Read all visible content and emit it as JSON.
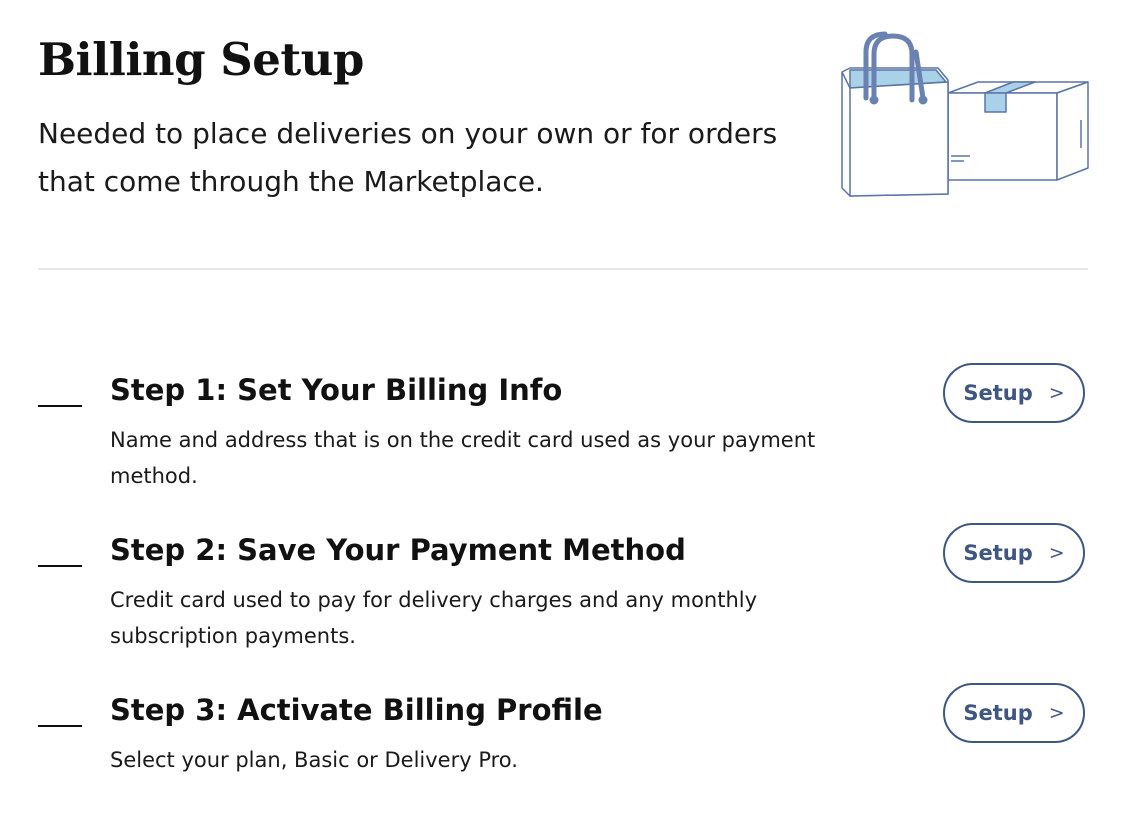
{
  "header": {
    "title": "Billing Setup",
    "subtitle": "Needed to place deliveries on your own or for orders that come through the Marketplace."
  },
  "illustration": {
    "icons": [
      "shopping-bag-icon",
      "shipping-box-icon"
    ]
  },
  "steps": [
    {
      "title": "Step 1: Set Your Billing Info",
      "description": "Name and address that is on the credit card used as your payment method.",
      "button_label": "Setup",
      "button_icon_glyph": ">"
    },
    {
      "title": "Step 2: Save Your Payment Method",
      "description": "Credit card used to pay for delivery charges and any monthly subscription payments.",
      "button_label": "Setup",
      "button_icon_glyph": ">"
    },
    {
      "title": "Step 3: Activate Billing Profile",
      "description": "Select your plan, Basic or Delivery Pro.",
      "button_label": "Setup",
      "button_icon_glyph": ">"
    }
  ],
  "colors": {
    "accent": "#3e5682",
    "illustration_blue": "#a9d2e8",
    "illustration_stroke": "#5b74a6",
    "text": "#111111",
    "divider": "#e6e6e6"
  }
}
